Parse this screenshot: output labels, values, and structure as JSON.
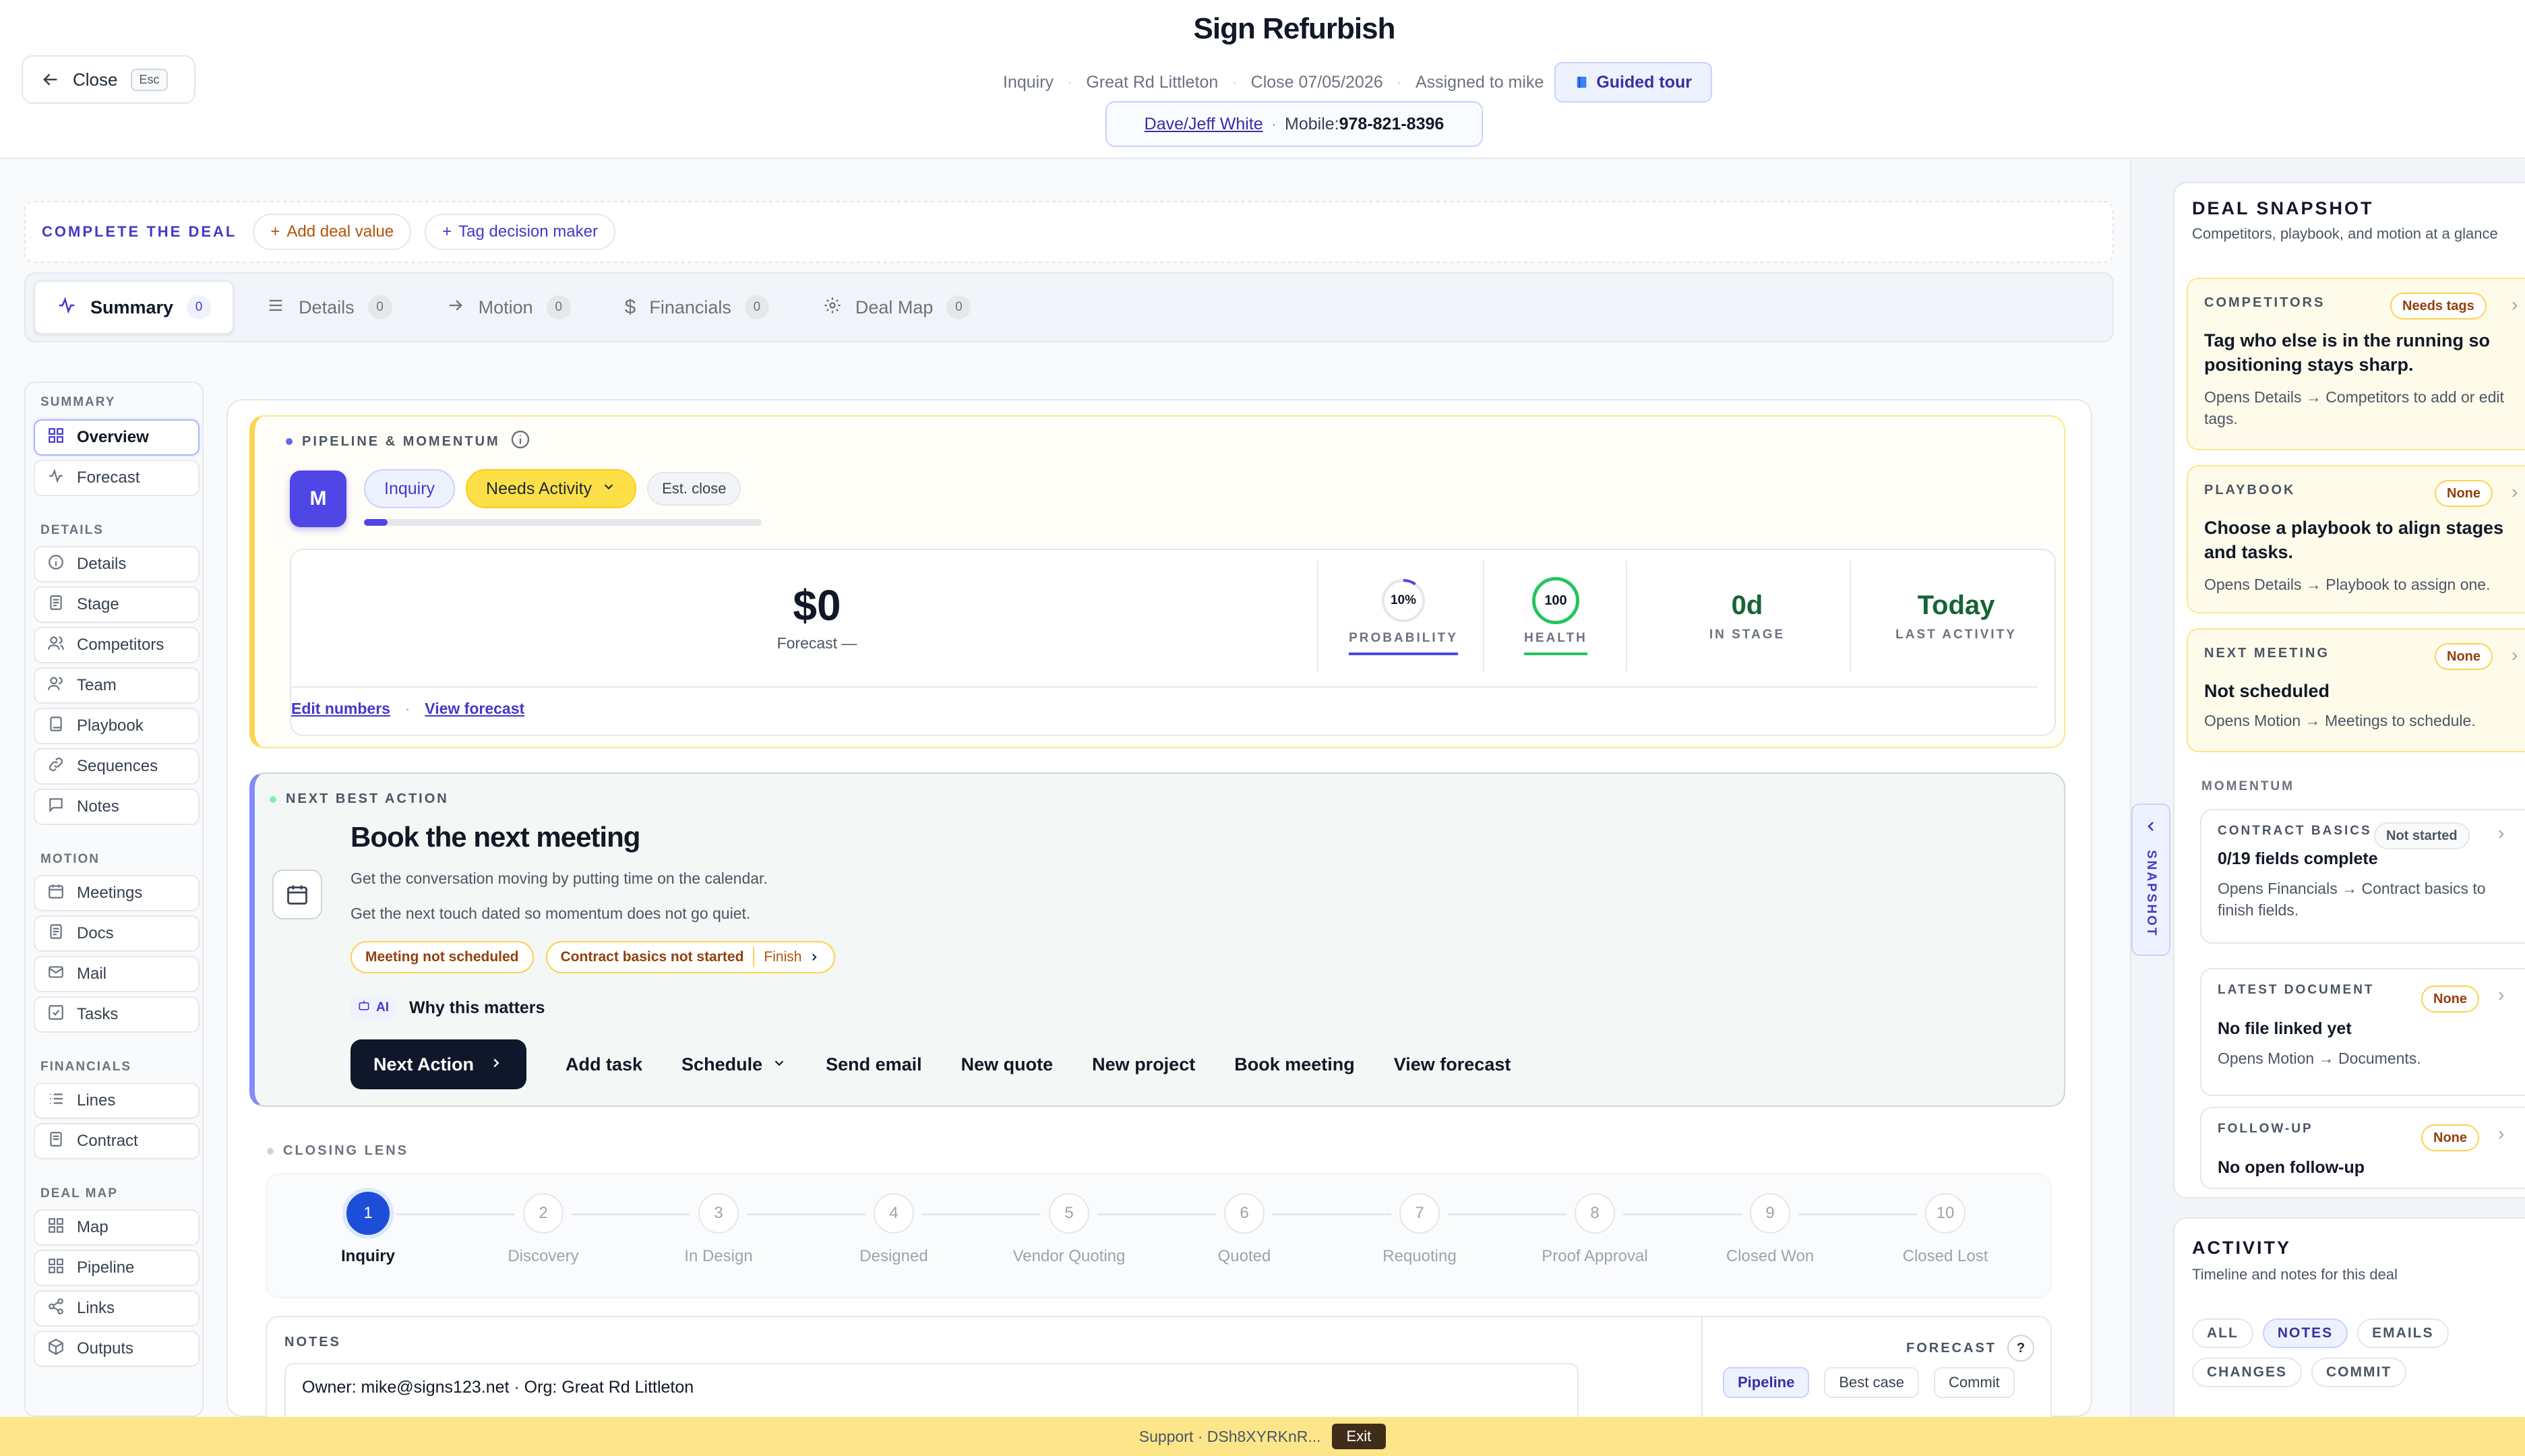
{
  "header": {
    "close_label": "Close",
    "close_key": "Esc",
    "title": "Sign Refurbish",
    "stage": "Inquiry",
    "org": "Great Rd Littleton",
    "close_date": "Close 07/05/2026",
    "assigned": "Assigned to mike",
    "guided_tour": "Guided tour",
    "contact_name": "Dave/Jeff White",
    "mobile_label": "Mobile:",
    "mobile": "978-821-8396"
  },
  "cta": {
    "label": "COMPLETE THE DEAL",
    "add_value": "Add deal value",
    "tag_decision": "Tag decision maker"
  },
  "tabs": [
    {
      "label": "Summary",
      "count": "0"
    },
    {
      "label": "Details",
      "count": "0"
    },
    {
      "label": "Motion",
      "count": "0"
    },
    {
      "label": "Financials",
      "count": "0"
    },
    {
      "label": "Deal Map",
      "count": "0"
    }
  ],
  "nav": {
    "summary_h": "SUMMARY",
    "overview": "Overview",
    "forecast": "Forecast",
    "details_h": "DETAILS",
    "details": "Details",
    "stage": "Stage",
    "competitors": "Competitors",
    "team": "Team",
    "playbook": "Playbook",
    "sequences": "Sequences",
    "notes": "Notes",
    "motion_h": "MOTION",
    "meetings": "Meetings",
    "docs": "Docs",
    "mail": "Mail",
    "tasks": "Tasks",
    "financials_h": "FINANCIALS",
    "lines": "Lines",
    "contract": "Contract",
    "dealmap_h": "DEAL MAP",
    "map": "Map",
    "pipeline": "Pipeline",
    "links": "Links",
    "outputs": "Outputs"
  },
  "pipeline": {
    "kicker": "PIPELINE & MOMENTUM",
    "avatar": "M",
    "stage_chip": "Inquiry",
    "activity_chip": "Needs Activity",
    "est_close": "Est. close",
    "progress": 0.06,
    "amount": "$0",
    "amount_caption": "Forecast —",
    "probability_value": "10%",
    "probability_label": "PROBABILITY",
    "probability_fraction": 0.1,
    "health_value": "100",
    "health_label": "HEALTH",
    "in_stage_value": "0d",
    "in_stage_label": "IN STAGE",
    "last_activity_value": "Today",
    "last_activity_label": "LAST ACTIVITY",
    "edit_numbers": "Edit numbers",
    "view_forecast": "View forecast"
  },
  "nba": {
    "kicker": "NEXT BEST ACTION",
    "title": "Book the next meeting",
    "line1": "Get the conversation moving by putting time on the calendar.",
    "line2": "Get the next touch dated so momentum does not go quiet.",
    "badge1": "Meeting not scheduled",
    "badge2": "Contract basics not started",
    "finish": "Finish",
    "ai": "AI",
    "why": "Why this matters",
    "next_action": "Next Action",
    "actions": [
      "Add task",
      "Schedule",
      "Send email",
      "New quote",
      "New project",
      "Book meeting",
      "View forecast"
    ]
  },
  "lens": {
    "kicker": "CLOSING LENS",
    "steps": [
      {
        "num": "1",
        "name": "Inquiry"
      },
      {
        "num": "2",
        "name": "Discovery"
      },
      {
        "num": "3",
        "name": "In Design"
      },
      {
        "num": "4",
        "name": "Designed"
      },
      {
        "num": "5",
        "name": "Vendor Quoting"
      },
      {
        "num": "6",
        "name": "Quoted"
      },
      {
        "num": "7",
        "name": "Requoting"
      },
      {
        "num": "8",
        "name": "Proof Approval"
      },
      {
        "num": "9",
        "name": "Closed Won"
      },
      {
        "num": "10",
        "name": "Closed Lost"
      }
    ]
  },
  "notes": {
    "kicker": "NOTES",
    "owner_line": "Owner: mike@signs123.net · Org: Great Rd Littleton",
    "forecast_h": "FORECAST",
    "help": "?",
    "pipeline": "Pipeline",
    "best_case": "Best case",
    "commit": "Commit"
  },
  "snapshot": {
    "title": "DEAL SNAPSHOT",
    "subtitle": "Competitors, playbook, and motion at a glance",
    "tab_label": "SNAPSHOT",
    "competitors_h": "COMPETITORS",
    "competitors_badge": "Needs tags",
    "competitors_t": "Tag who else is in the running so positioning stays sharp.",
    "competitors_s": "Opens Details → Competitors to add or edit tags.",
    "playbook_h": "PLAYBOOK",
    "playbook_badge": "None",
    "playbook_t": "Choose a playbook to align stages and tasks.",
    "playbook_s": "Opens Details → Playbook to assign one.",
    "meeting_h": "NEXT MEETING",
    "meeting_badge": "None",
    "meeting_t": "Not scheduled",
    "meeting_s": "Opens Motion → Meetings to schedule.",
    "momentum_h": "MOMENTUM",
    "contract_h": "CONTRACT BASICS",
    "contract_badge": "Not started",
    "contract_t": "0/19 fields complete",
    "contract_s": "Opens Financials → Contract basics to finish fields.",
    "doc_h": "LATEST DOCUMENT",
    "doc_badge": "None",
    "doc_t": "No file linked yet",
    "doc_s": "Opens Motion → Documents.",
    "follow_h": "FOLLOW-UP",
    "follow_badge": "None",
    "follow_t": "No open follow-up"
  },
  "activity": {
    "title": "ACTIVITY",
    "subtitle": "Timeline and notes for this deal",
    "filters": [
      "ALL",
      "NOTES",
      "EMAILS",
      "CHANGES",
      "COMMIT"
    ]
  },
  "banner": {
    "text": "Support · DSh8XYRKnR...",
    "exit": "Exit"
  },
  "colors": {
    "accent": "#4f46e5",
    "warning": "#fcd34d",
    "health": "#22c55e",
    "banner": "#fde68a"
  }
}
